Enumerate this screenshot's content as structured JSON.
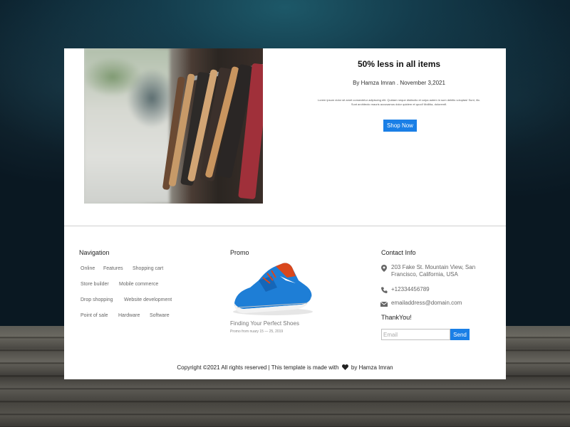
{
  "hero": {
    "title": "50% less in all items",
    "byline": "By Hamza Imran . November 3,2021",
    "body": "Lorem ipsum dolor sit amet consectetur adipiscing elit. Quidam neque distinctio et culpa autem in sum debitis voluptas! Sunt, illo. Sunt architecto mauris accusamus dolor quidem et quod! Mollitia, doloremfl.",
    "shop_button": "Shop Now"
  },
  "footer": {
    "navigation": {
      "heading": "Navigation",
      "links": [
        "Online",
        "Features",
        "Shopping cart",
        "Store builder",
        "Mobile commerce",
        "Drop shopping",
        "Website development",
        "Point of sale",
        "Hardware",
        "Software"
      ]
    },
    "promo": {
      "heading": "Promo",
      "caption": "Finding Your Perfect Shoes",
      "subcaption": "Promo from nuary 15 — 25, 2019"
    },
    "contact": {
      "heading": "Contact Info",
      "address_line1": "203 Fake St. Mountain View, San",
      "address_line2": "Francisco, California, USA",
      "phone": "+12334456789",
      "email": "emailaddress@domain.com",
      "icons": [
        "map-pin-icon",
        "phone-icon",
        "envelope-icon"
      ]
    },
    "newsletter": {
      "heading": "ThankYou!",
      "placeholder": "Email",
      "send_label": "Send"
    },
    "copyright_before": "Copyright ©2021 All rights reserved | This template is made with",
    "copyright_after": "by Hamza Imran"
  },
  "colors": {
    "accent": "#1a7fe6",
    "page_background": "#ffffff",
    "backdrop": "#0c1a24"
  }
}
